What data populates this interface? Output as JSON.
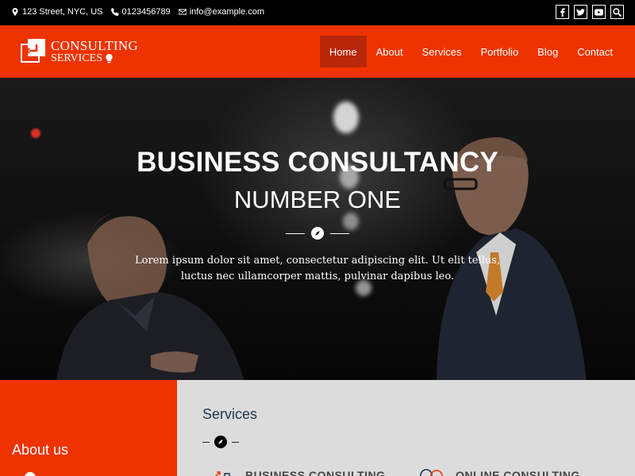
{
  "topbar": {
    "address": "123 Street, NYC, US",
    "phone": "0123456789",
    "email": "info@example.com",
    "social": [
      "facebook-icon",
      "twitter-icon",
      "youtube-icon",
      "search-icon"
    ]
  },
  "logo": {
    "line1": "CONSULTING",
    "line2": "SERVICES"
  },
  "nav": {
    "items": [
      {
        "label": "Home",
        "active": true
      },
      {
        "label": "About"
      },
      {
        "label": "Services"
      },
      {
        "label": "Portfolio"
      },
      {
        "label": "Blog"
      },
      {
        "label": "Contact"
      }
    ]
  },
  "hero": {
    "title": "BUSINESS CONSULTANCY",
    "subtitle": "NUMBER ONE",
    "text": "Lorem ipsum dolor sit amet, consectetur adipiscing elit. Ut elit tellus, luctus nec ullamcorper mattis, pulvinar dapibus leo."
  },
  "about": {
    "heading": "About us"
  },
  "services": {
    "heading": "Services",
    "items": [
      {
        "label": "BUSINESS CONSULTING"
      },
      {
        "label": "ONLINE CONSULTING"
      }
    ]
  },
  "colors": {
    "brand": "#ee3300",
    "active_nav": "#b8270a",
    "services_bg": "#dcdcdc",
    "heading_blue": "#1d3550"
  }
}
